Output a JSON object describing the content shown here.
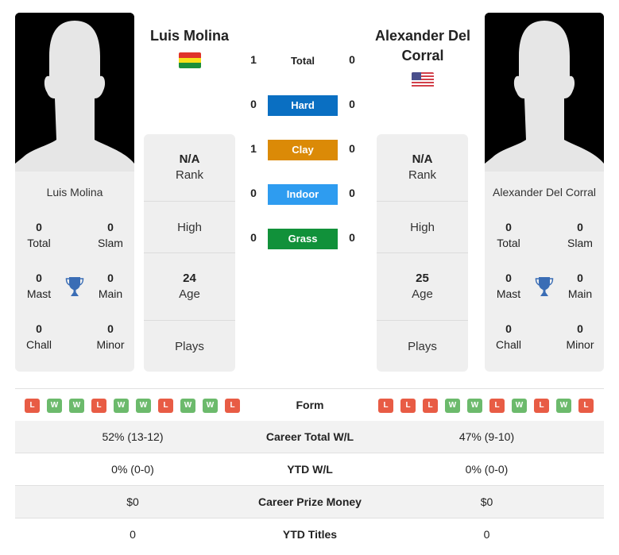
{
  "player1": {
    "name": "Luis Molina",
    "country": "Bolivia",
    "flag_icon": "bolivia-flag-icon",
    "titles": {
      "total": {
        "value": "0",
        "label": "Total"
      },
      "slam": {
        "value": "0",
        "label": "Slam"
      },
      "mast": {
        "value": "0",
        "label": "Mast"
      },
      "main": {
        "value": "0",
        "label": "Main"
      },
      "chall": {
        "value": "0",
        "label": "Chall"
      },
      "minor": {
        "value": "0",
        "label": "Minor"
      }
    },
    "rank": {
      "value": "N/A",
      "label": "Rank"
    },
    "high": {
      "label": "High"
    },
    "age": {
      "value": "24",
      "label": "Age"
    },
    "plays": {
      "label": "Plays"
    },
    "form": [
      "L",
      "W",
      "W",
      "L",
      "W",
      "W",
      "L",
      "W",
      "W",
      "L"
    ],
    "career_wl": "52% (13-12)",
    "ytd_wl": "0% (0-0)",
    "prize": "$0",
    "ytd_titles": "0"
  },
  "player2": {
    "name": "Alexander Del Corral",
    "name_line1": "Alexander Del",
    "name_line2": "Corral",
    "country": "United States",
    "flag_icon": "usa-flag-icon",
    "titles": {
      "total": {
        "value": "0",
        "label": "Total"
      },
      "slam": {
        "value": "0",
        "label": "Slam"
      },
      "mast": {
        "value": "0",
        "label": "Mast"
      },
      "main": {
        "value": "0",
        "label": "Main"
      },
      "chall": {
        "value": "0",
        "label": "Chall"
      },
      "minor": {
        "value": "0",
        "label": "Minor"
      }
    },
    "rank": {
      "value": "N/A",
      "label": "Rank"
    },
    "high": {
      "label": "High"
    },
    "age": {
      "value": "25",
      "label": "Age"
    },
    "plays": {
      "label": "Plays"
    },
    "form": [
      "L",
      "L",
      "L",
      "W",
      "W",
      "L",
      "W",
      "L",
      "W",
      "L"
    ],
    "career_wl": "47% (9-10)",
    "ytd_wl": "0% (0-0)",
    "prize": "$0",
    "ytd_titles": "0"
  },
  "h2h": {
    "total": {
      "label": "Total",
      "p1": "1",
      "p2": "0"
    },
    "surfaces": [
      {
        "label": "Hard",
        "p1": "0",
        "p2": "0",
        "color": "#0a6fc2"
      },
      {
        "label": "Clay",
        "p1": "1",
        "p2": "0",
        "color": "#db8a07"
      },
      {
        "label": "Indoor",
        "p1": "0",
        "p2": "0",
        "color": "#2e9cf0"
      },
      {
        "label": "Grass",
        "p1": "0",
        "p2": "0",
        "color": "#11913a"
      }
    ]
  },
  "comparison": {
    "form_label": "Form",
    "rows": [
      {
        "label": "Career Total W/L"
      },
      {
        "label": "YTD W/L"
      },
      {
        "label": "Career Prize Money"
      },
      {
        "label": "YTD Titles"
      }
    ]
  }
}
